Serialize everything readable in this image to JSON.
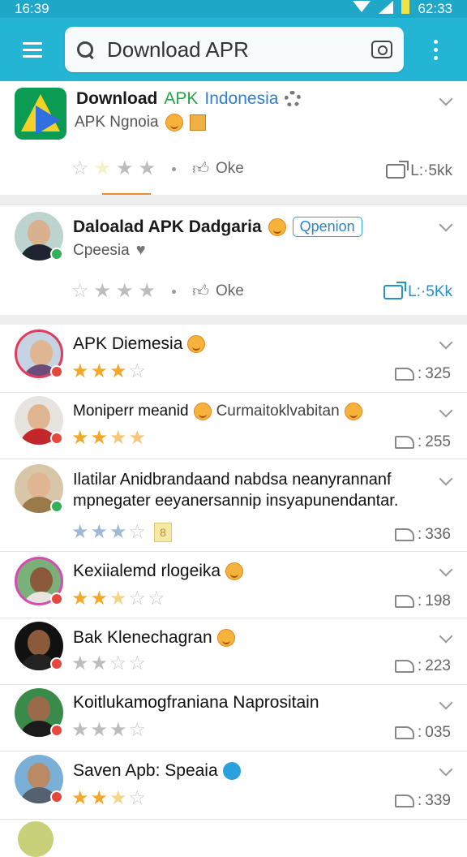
{
  "status_bar": {
    "time": "16:39",
    "right_text": "62:33"
  },
  "search": {
    "value": "Download APR"
  },
  "app_card": {
    "title_bold": "Download",
    "title_green": "APK",
    "title_blue": "Indonesia",
    "subtitle": "APK Ngnoia",
    "like_label": "Oke",
    "share_label": "L:·5kk",
    "rating": 1
  },
  "post_card": {
    "title": "Daloalad APK Dadgaria",
    "chip": "Qpenion",
    "subtitle": "Cpeesia",
    "like_label": "Oke",
    "share_label": "L:·5Kk"
  },
  "reviews": [
    {
      "name": "APK Diemesia",
      "name_extra": "",
      "stars": 3,
      "count": "325"
    },
    {
      "name": "Moniperr meanid",
      "name_extra": "Curmaitoklvabitan",
      "stars": 4,
      "count": "255"
    },
    {
      "name": "Ilatilar Anidbrandaand nabdsa neanyrannanf",
      "name_extra": "mpnegater eeyanersannip insyapunendantar.",
      "stars": 3,
      "count": "336"
    },
    {
      "name": "Kexiialemd rlogeika",
      "name_extra": "",
      "stars": 2.5,
      "count": "198"
    },
    {
      "name": "Bak Klenechagran",
      "name_extra": "",
      "stars": 2,
      "count": "223"
    },
    {
      "name": "Koitlukamogfraniana Naprositain",
      "name_extra": "",
      "stars": 3,
      "count": "035"
    },
    {
      "name": "Saven Apb: Speaia",
      "name_extra": "",
      "stars": 2.5,
      "count": "339"
    }
  ],
  "colors": {
    "header": "#25b5d4",
    "star": "#f3a829",
    "accent": "#f08a2c"
  },
  "icons": [
    "menu-icon",
    "search-icon",
    "camera-icon",
    "more-vert-icon",
    "gear-icon",
    "star-icon",
    "like-icon",
    "share-icon",
    "reply-icon",
    "chevron-down-icon"
  ]
}
